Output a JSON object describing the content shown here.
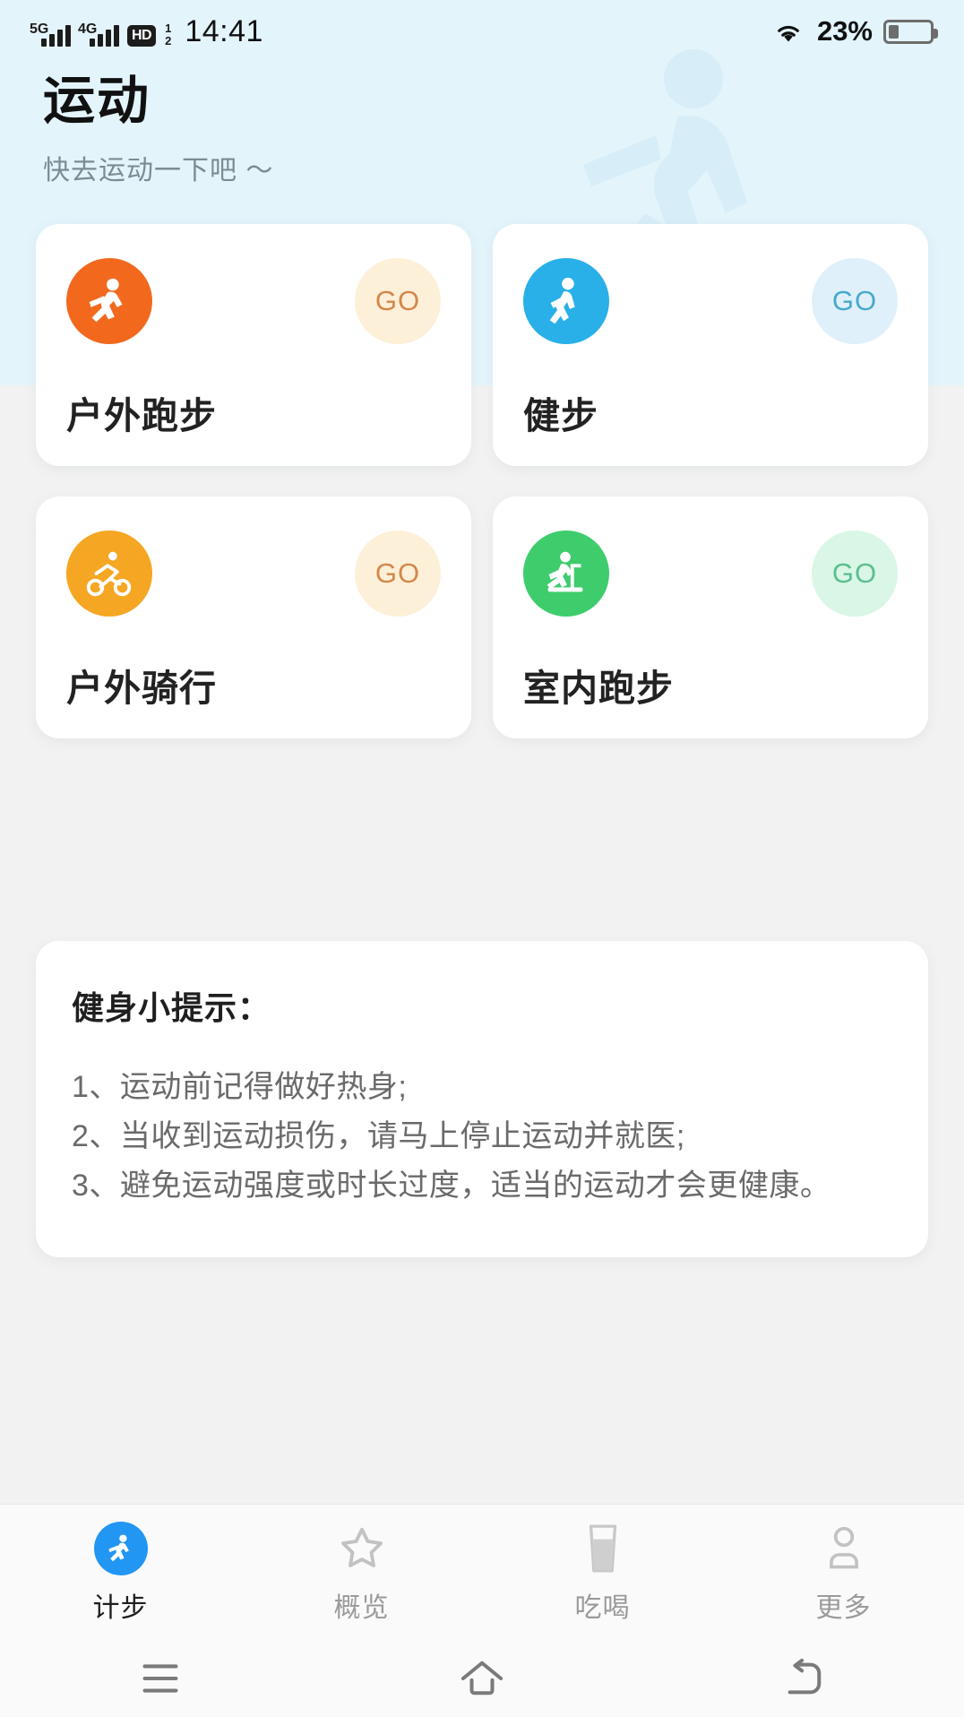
{
  "statusbar": {
    "net1_label": "5G",
    "net2_label": "4G",
    "hd_label": "HD",
    "hd_sup": "1",
    "hd_sub": "2",
    "time": "14:41",
    "battery_percent": "23%",
    "wifi_icon": "wifi-icon",
    "battery_icon": "battery-icon"
  },
  "header": {
    "title": "运动",
    "subtitle": "快去运动一下吧 ～",
    "background_color": "#e3f4fb",
    "decoration_icon": "running-person-silhouette-icon"
  },
  "sports": [
    {
      "label": "户外跑步",
      "icon": "outdoor-running-icon",
      "icon_color": "#F2691E",
      "go_label": "GO",
      "go_bg": "#FDF0D8",
      "go_color": "#D4874A"
    },
    {
      "label": "健步",
      "icon": "walking-icon",
      "icon_color": "#29B0E8",
      "go_label": "GO",
      "go_bg": "#DFF0FA",
      "go_color": "#47A9C9"
    },
    {
      "label": "户外骑行",
      "icon": "cycling-icon",
      "icon_color": "#F5A623",
      "go_label": "GO",
      "go_bg": "#FDF0D8",
      "go_color": "#D4874A"
    },
    {
      "label": "室内跑步",
      "icon": "treadmill-icon",
      "icon_color": "#3ECC6D",
      "go_label": "GO",
      "go_bg": "#D9F6E6",
      "go_color": "#5BBF8D"
    }
  ],
  "tips": {
    "title": "健身小提示：",
    "items": [
      "1、运动前记得做好热身;",
      "2、当收到运动损伤，请马上停止运动并就医;",
      "3、避免运动强度或时长过度，适当的运动才会更健康。"
    ]
  },
  "tabbar": {
    "accent_color": "#2196f3",
    "items": [
      {
        "label": "计步",
        "icon": "step-counter-icon",
        "active": true
      },
      {
        "label": "概览",
        "icon": "star-icon",
        "active": false
      },
      {
        "label": "吃喝",
        "icon": "drink-glass-icon",
        "active": false
      },
      {
        "label": "更多",
        "icon": "person-icon",
        "active": false
      }
    ]
  },
  "navbar": {
    "items": [
      {
        "icon": "menu-recents-icon"
      },
      {
        "icon": "home-icon"
      },
      {
        "icon": "back-icon"
      }
    ]
  }
}
